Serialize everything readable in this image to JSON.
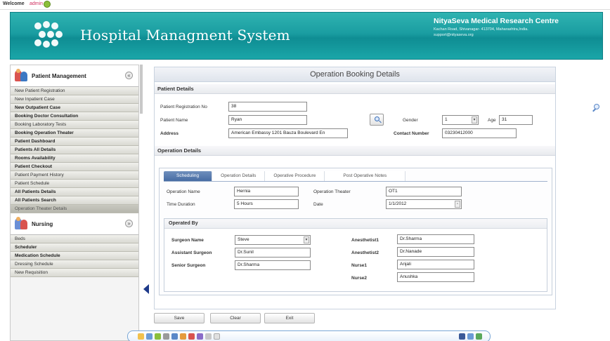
{
  "welcome": {
    "text": "Welcome",
    "user": "admin"
  },
  "header": {
    "title": "Hospital Managment System",
    "org_name": "NityaSeva Medical Research Centre",
    "org_address": "Kachan Road, Shivanagar- 413704, Maharashtra,India.",
    "org_email": "support@nityaseva.org"
  },
  "sidebar": {
    "patient_section": "Patient Management",
    "patient_items": [
      "New Patient Registration",
      "New Inpatient Case",
      "New Outpatient Case",
      "Booking Doctor Consultation",
      "Booking Laboratory Tests",
      "Booking Operation Theater",
      "Patient Dashboard",
      "Patients All Details",
      "Rooms Availability",
      "Patient Checkout",
      "Patient Payment History",
      "Patient Schedule",
      "All Patients Details",
      "All Patients Search",
      "Operation Theater Details"
    ],
    "nursing_section": "Nursing",
    "nursing_items": [
      "Beds",
      "Scheduler",
      "Medication Schedule",
      "Dressing Schedule",
      "New Requisition"
    ]
  },
  "main": {
    "title": "Operation Booking Details",
    "patient_section": "Patient Details",
    "labels": {
      "reg_no": "Patient Registration No",
      "name": "Patient Name",
      "address": "Address",
      "gender": "Gender",
      "age": "Age",
      "contact": "Contact Number"
    },
    "values": {
      "reg_no": "38",
      "name": "Ryan",
      "address": "American Embassy 1201 Bauza Boulevard En",
      "gender": "1",
      "age": "31",
      "contact": "03230412000"
    },
    "operation_section": "Operation Details",
    "tabs": [
      "Scheduling",
      "Operation Details",
      "Operative Procedure",
      "Post Operative Notes"
    ],
    "sched_labels": {
      "op_name": "Operation Name",
      "theater": "Operation Theater",
      "duration": "Time Duration",
      "date": "Date"
    },
    "sched_values": {
      "op_name": "Hernia",
      "theater": "OT1",
      "duration": "5 Hours",
      "date": "1/1/2012"
    },
    "operated_by": {
      "heading": "Operated By",
      "surgeon_label": "Surgeon Name",
      "surgeon_value": "Steve",
      "assistant_label": "Assistant Surgeon",
      "assistant_value": "Dr.Sunil",
      "senior_label": "Senior Surgeon",
      "senior_value": "Dr.Sharma",
      "anes1_label": "Anesthetist1",
      "anes1_value": "Dr.Sharma",
      "anes2_label": "Anesthetist2",
      "anes2_value": "Dr.Nanade",
      "nurse1_label": "Nurse1",
      "nurse1_value": "Anjali",
      "nurse2_label": "Nurse2",
      "nurse2_value": "Anushka"
    },
    "buttons": {
      "save": "Save",
      "clear": "Clear",
      "exit": "Exit"
    }
  }
}
